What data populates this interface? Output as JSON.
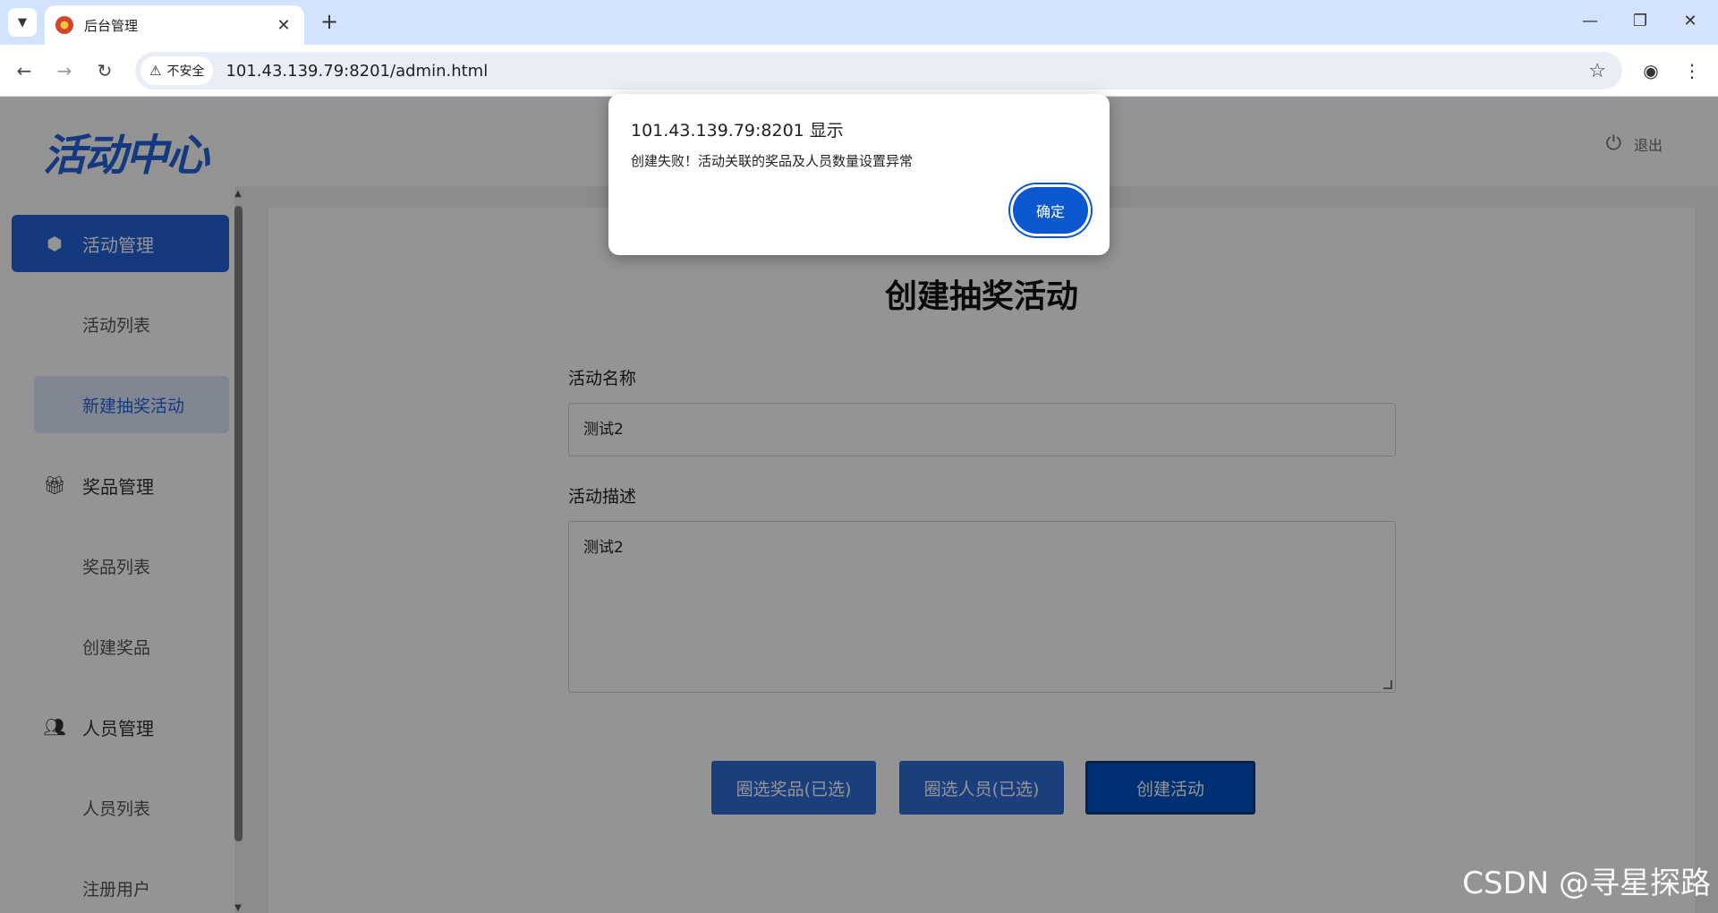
{
  "browser": {
    "tab_title": "后台管理",
    "url": "101.43.139.79:8201/admin.html",
    "security_label": "不安全"
  },
  "header": {
    "logo": "活动中心",
    "logout": "退出"
  },
  "sidebar": {
    "sections": [
      {
        "label": "活动管理",
        "icon": "cube-icon",
        "active": true
      },
      {
        "label": "奖品管理",
        "icon": "gift-icon",
        "active": false
      },
      {
        "label": "人员管理",
        "icon": "users-icon",
        "active": false
      }
    ],
    "items": [
      {
        "label": "活动列表"
      },
      {
        "label": "新建抽奖活动",
        "selected": true
      },
      {
        "label": "奖品列表"
      },
      {
        "label": "创建奖品"
      },
      {
        "label": "人员列表"
      },
      {
        "label": "注册用户"
      }
    ]
  },
  "form": {
    "title": "创建抽奖活动",
    "name_label": "活动名称",
    "name_value": "测试2",
    "desc_label": "活动描述",
    "desc_value": "测试2",
    "select_prizes": "圈选奖品(已选)",
    "select_people": "圈选人员(已选)",
    "create": "创建活动"
  },
  "dialog": {
    "origin": "101.43.139.79:8201 显示",
    "message": "创建失败！活动关联的奖品及人员数量设置异常",
    "ok": "确定"
  },
  "watermark": "CSDN @寻星探路",
  "colors": {
    "brand": "#2563d9",
    "dialog_button": "#0b57d0"
  }
}
